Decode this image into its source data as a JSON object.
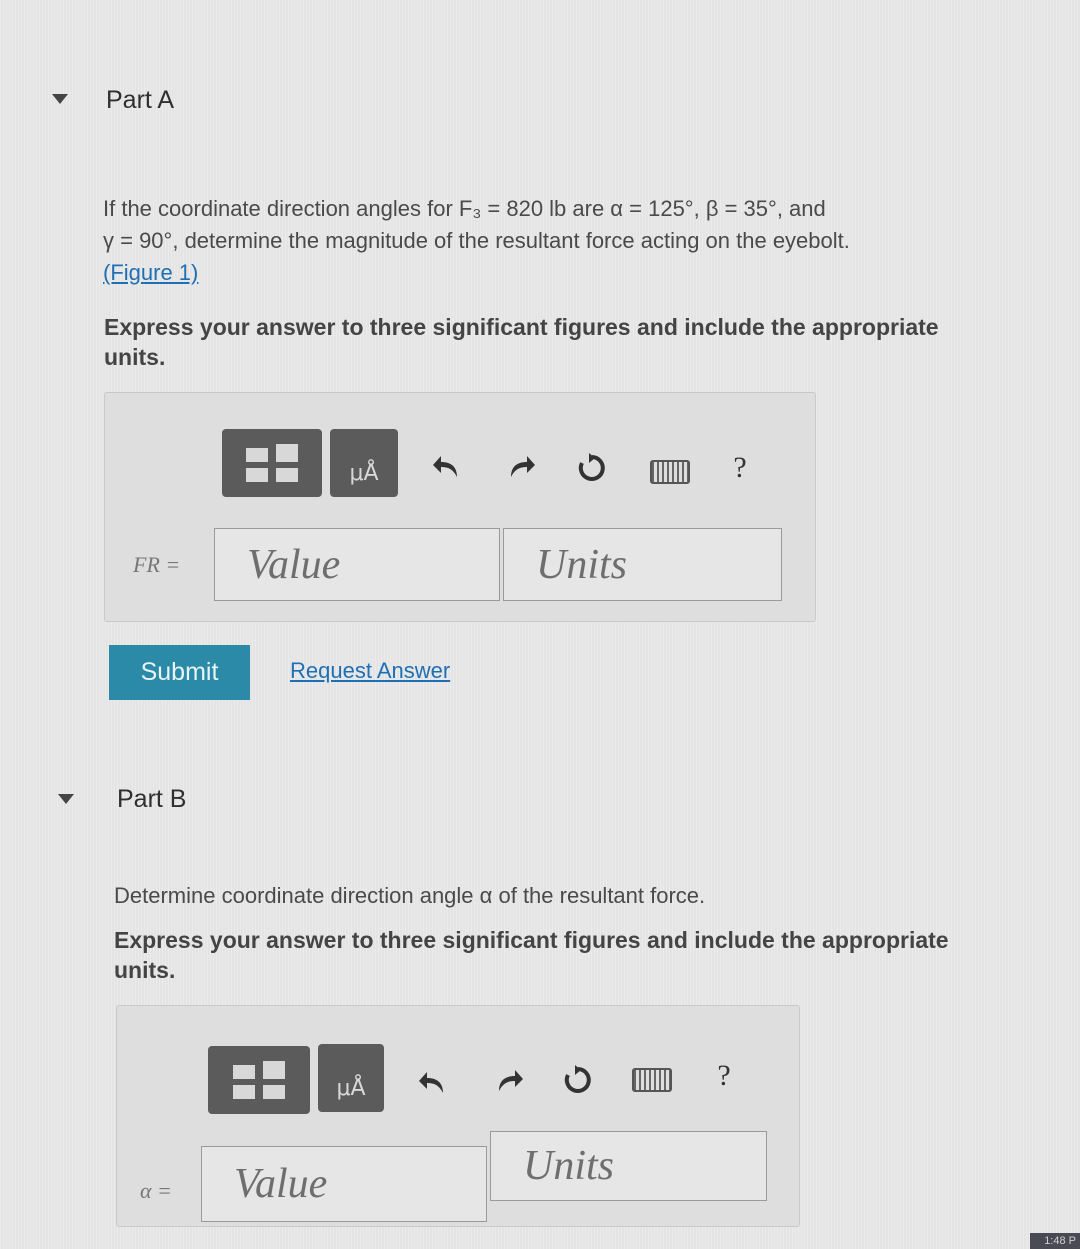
{
  "part_a": {
    "title": "Part A",
    "question_line1": "If the coordinate direction angles for F₃ = 820 lb are α = 125°, β = 35°, and",
    "question_line2": "γ = 90°, determine the magnitude of the resultant force acting on the eyebolt.",
    "figure_link": "(Figure 1)",
    "instruction_line1": "Express your answer to three significant figures and include the appropriate",
    "instruction_line2": "units.",
    "variable_label": "FR =",
    "value_placeholder": "Value",
    "units_placeholder": "Units",
    "submit_label": "Submit",
    "request_answer_label": "Request Answer"
  },
  "part_b": {
    "title": "Part B",
    "question": "Determine coordinate direction angle α of the resultant force.",
    "instruction_line1": "Express your answer to three significant figures and include the appropriate",
    "instruction_line2": "units.",
    "variable_label": "α =",
    "value_placeholder": "Value",
    "units_placeholder": "Units"
  },
  "toolbar": {
    "units_glyph": "μÅ",
    "help_label": "?",
    "icons": [
      "templates-icon",
      "units-icon",
      "undo-icon",
      "redo-icon",
      "reset-icon",
      "keyboard-icon",
      "help-icon"
    ]
  },
  "clock_text": "1:48 P",
  "colors": {
    "submit_bg": "#2a8aa8",
    "link": "#1f6fb5",
    "toolbar_button_bg": "#5b5b5b",
    "page_bg": "#e4e4e4"
  }
}
